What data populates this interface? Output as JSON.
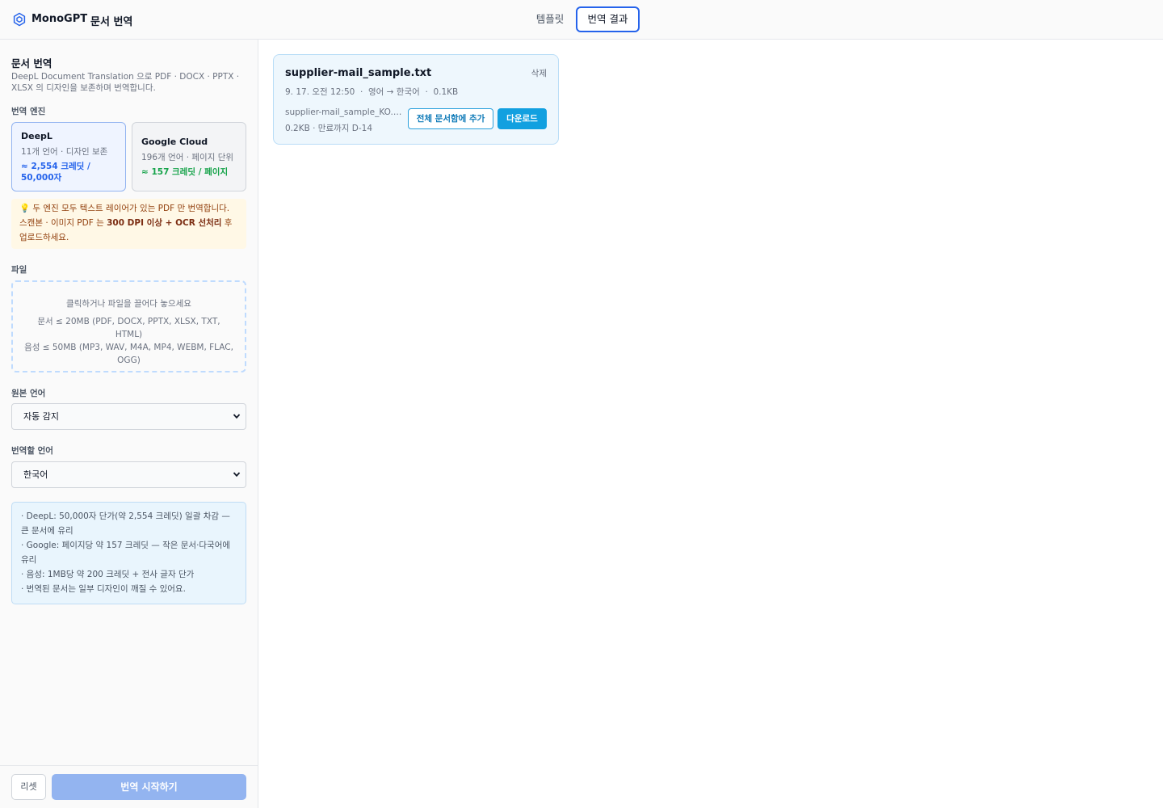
{
  "header": {
    "brand": "MonoGPT",
    "page_name": "문서 번역",
    "tabs": [
      {
        "label": "템플릿",
        "active": false
      },
      {
        "label": "번역 결과",
        "active": true
      }
    ]
  },
  "sidebar": {
    "title": "문서 번역",
    "description": "DeepL Document Translation 으로 PDF · DOCX · PPTX · XLSX 의 디자인을 보존하며 번역합니다.",
    "engine_label": "번역 엔진",
    "engines": [
      {
        "name": "DeepL",
        "meta": "11개 언어 · 디자인 보존",
        "cost": "≈ 2,554 크레딧 / 50,000자",
        "selected": true
      },
      {
        "name": "Google Cloud",
        "meta": "196개 언어 · 페이지 단위",
        "cost": "≈ 157 크레딧 / 페이지",
        "selected": false
      }
    ],
    "notice": {
      "icon": "💡",
      "text_before": "두 엔진 모두 텍스트 레이어가 있는 PDF 만 번역합니다. 스캔본 · 이미지 PDF 는 ",
      "bold": "300 DPI 이상 + OCR 선처리",
      "text_after": " 후 업로드하세요."
    },
    "file_label": "파일",
    "dropzone": {
      "hint": "클릭하거나 파일을 끌어다 놓으세요",
      "docs": "문서 ≤ 20MB (PDF, DOCX, PPTX, XLSX, TXT, HTML)",
      "audio": "음성 ≤ 50MB (MP3, WAV, M4A, MP4, WEBM, FLAC, OGG)"
    },
    "source_lang_label": "원본 언어",
    "source_lang_value": "자동 감지",
    "target_lang_label": "번역할 언어",
    "target_lang_value": "한국어",
    "info_lines": [
      "· DeepL: 50,000자 단가(약 2,554 크레딧) 일괄 차감 — 큰 문서에 유리",
      "· Google: 페이지당 약 157 크레딧 — 작은 문서·다국어에 유리",
      "· 음성: 1MB당 약 200 크레딧 + 전사 글자 단가",
      "· 번역된 문서는 일부 디자인이 깨질 수 있어요."
    ],
    "reset_label": "리셋",
    "start_label": "번역 시작하기"
  },
  "result": {
    "file_name": "supplier-mail_sample.txt",
    "delete_label": "삭제",
    "meta": "9. 17. 오전 12:50  ·  영어 → 한국어  ·  0.1KB",
    "output_name": "supplier-mail_sample_KO.txt",
    "output_meta": "0.2KB · 만료까지 D-14",
    "add_label": "전체 문서함에 추가",
    "download_label": "다운로드"
  },
  "colors": {
    "accent": "#2563eb",
    "download": "#12a0e0",
    "start_disabled": "#93b4f0",
    "notice_bg": "#fff8e6"
  }
}
